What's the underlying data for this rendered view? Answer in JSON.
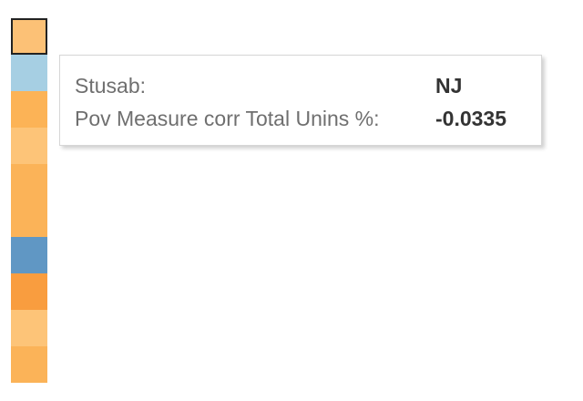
{
  "heatmap": {
    "cells": [
      {
        "color": "#fcc176",
        "selected": true
      },
      {
        "color": "#a6cfe3",
        "selected": false
      },
      {
        "color": "#fcb356",
        "selected": false
      },
      {
        "color": "#fdc478",
        "selected": false
      },
      {
        "color": "#fbb358",
        "selected": false
      },
      {
        "color": "#fbb358",
        "selected": false
      },
      {
        "color": "#6097c4",
        "selected": false
      },
      {
        "color": "#f99d3f",
        "selected": false
      },
      {
        "color": "#fdc478",
        "selected": false
      },
      {
        "color": "#fbb358",
        "selected": false
      }
    ]
  },
  "tooltip": {
    "rows": [
      {
        "label": "Stusab:",
        "value": "NJ"
      },
      {
        "label": "Pov Measure corr Total Unins %:",
        "value": "-0.0335"
      }
    ]
  }
}
